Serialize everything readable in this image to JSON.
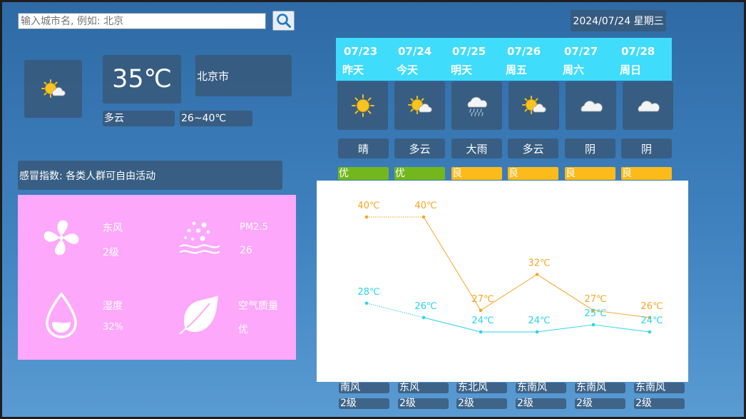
{
  "search": {
    "placeholder": "输入城市名, 例如: 北京",
    "button_icon": "search-icon"
  },
  "date_display": "2024/07/24 星期三",
  "current": {
    "icon": "partly-cloudy-icon",
    "temperature": "35℃",
    "city": "北京市",
    "condition": "多云",
    "range": "26~40℃"
  },
  "cold_index": "感冒指数: 各类人群可自由活动",
  "details": {
    "wind_dir_label": "东风",
    "wind_level": "2级",
    "pm_label": "PM2.5",
    "pm_value": "26",
    "humidity_label": "湿度",
    "humidity_value": "32%",
    "air_label": "空气质量",
    "air_value": "优"
  },
  "colors": {
    "header_bg": "#3fdcfc",
    "detail_bg": "#fda8fb",
    "aq_good": "#72b71c",
    "aq_fair": "#fbbb1b",
    "high_line": "#f5a623",
    "low_line": "#29d4ec"
  },
  "forecast": [
    {
      "date": "07/23",
      "day": "昨天",
      "icon": "sunny-icon",
      "condition": "晴",
      "aq": "优",
      "aq_color": "#72b71c",
      "wind_dir": "南风",
      "wind_level": "2级"
    },
    {
      "date": "07/24",
      "day": "今天",
      "icon": "partly-cloudy-icon",
      "condition": "多云",
      "aq": "优",
      "aq_color": "#72b71c",
      "wind_dir": "东风",
      "wind_level": "2级"
    },
    {
      "date": "07/25",
      "day": "明天",
      "icon": "heavy-rain-icon",
      "condition": "大雨",
      "aq": "良",
      "aq_color": "#fbbb1b",
      "wind_dir": "东北风",
      "wind_level": "2级"
    },
    {
      "date": "07/26",
      "day": "周五",
      "icon": "partly-cloudy-icon",
      "condition": "多云",
      "aq": "良",
      "aq_color": "#fbbb1b",
      "wind_dir": "东南风",
      "wind_level": "2级"
    },
    {
      "date": "07/27",
      "day": "周六",
      "icon": "overcast-icon",
      "condition": "阴",
      "aq": "良",
      "aq_color": "#fbbb1b",
      "wind_dir": "东南风",
      "wind_level": "2级"
    },
    {
      "date": "07/28",
      "day": "周日",
      "icon": "overcast-icon",
      "condition": "阴",
      "aq": "良",
      "aq_color": "#fbbb1b",
      "wind_dir": "东南风",
      "wind_level": "2级"
    }
  ],
  "chart_data": {
    "type": "line",
    "categories": [
      "07/23",
      "07/24",
      "07/25",
      "07/26",
      "07/27",
      "07/28"
    ],
    "series": [
      {
        "values": [
          40,
          40,
          27,
          32,
          27,
          26
        ],
        "labels": [
          "40℃",
          "40℃",
          "27℃",
          "32℃",
          "27℃",
          "26℃"
        ],
        "color": "#f5a623"
      },
      {
        "values": [
          28,
          26,
          24,
          24,
          25,
          24
        ],
        "labels": [
          "28℃",
          "26℃",
          "24℃",
          "24℃",
          "25℃",
          "24℃"
        ],
        "color": "#29d4ec"
      }
    ],
    "first_segment_style": "dotted",
    "grid": false,
    "legend": "none"
  }
}
